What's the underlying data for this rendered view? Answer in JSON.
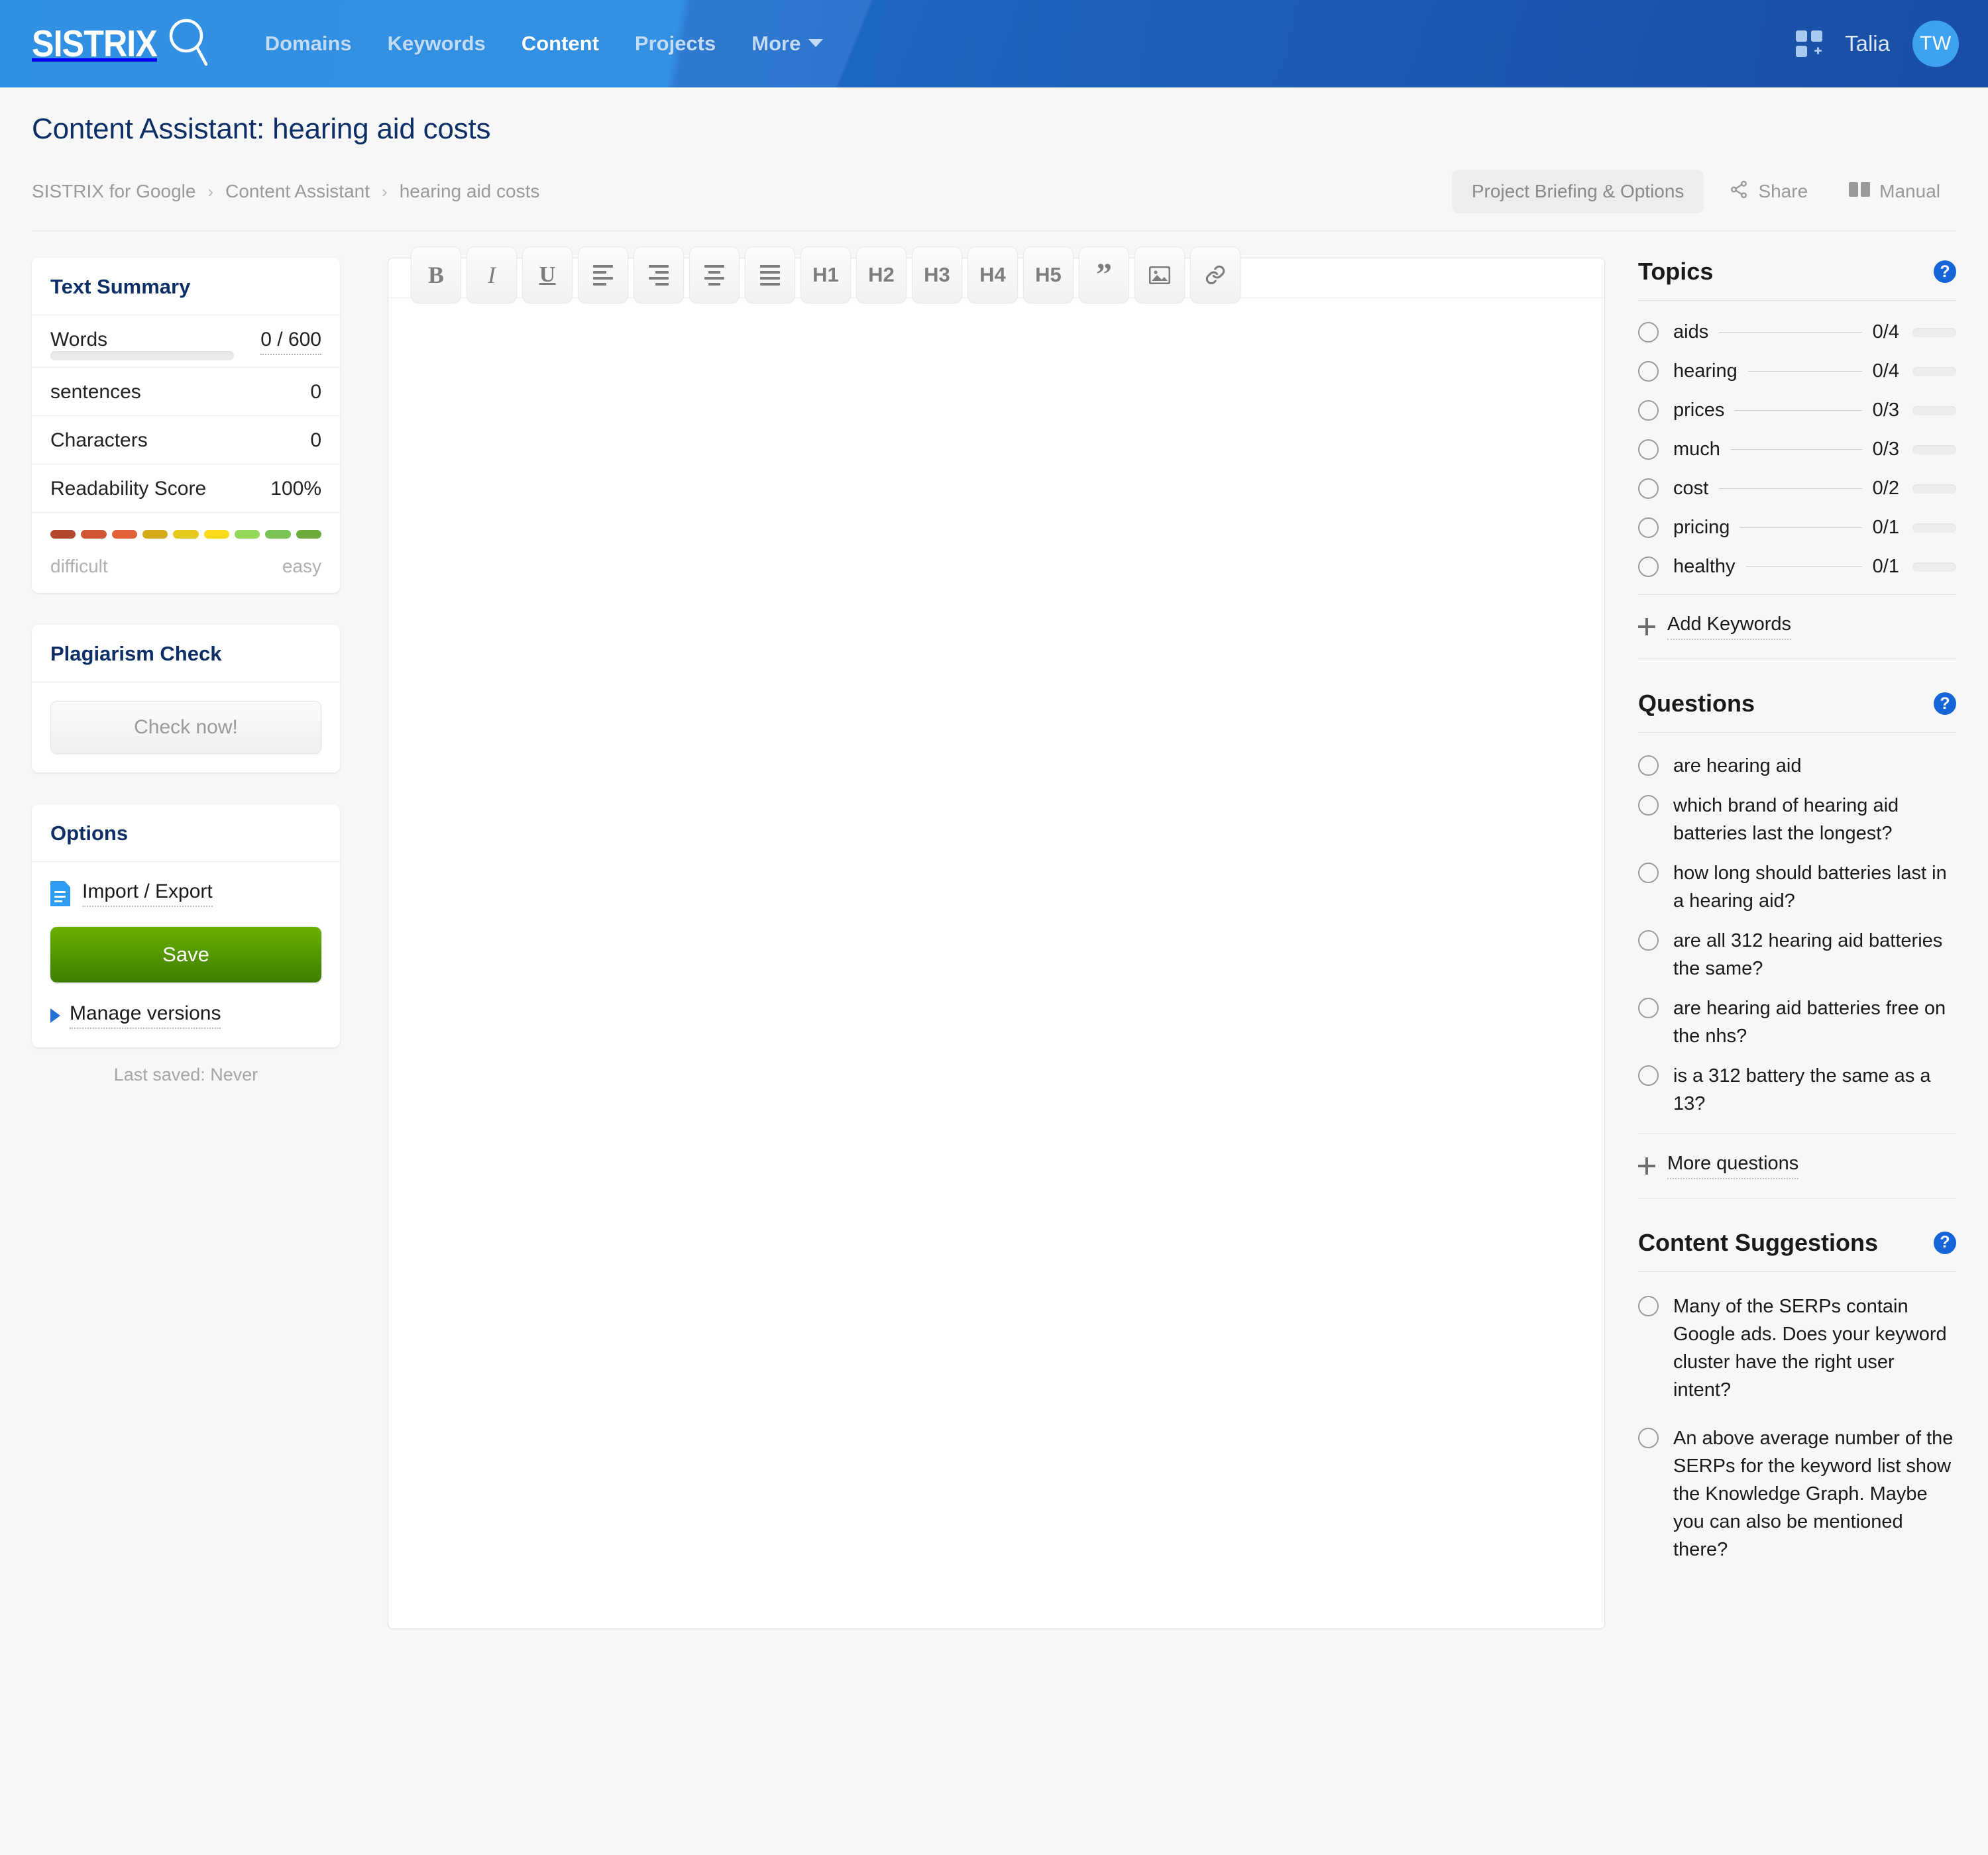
{
  "topnav": {
    "logo_text": "SISTRIX",
    "logo_icon": "magnifier-icon",
    "links": [
      {
        "label": "Domains",
        "active": false
      },
      {
        "label": "Keywords",
        "active": false
      },
      {
        "label": "Content",
        "active": true
      },
      {
        "label": "Projects",
        "active": false
      },
      {
        "label": "More",
        "active": false,
        "caret": true
      }
    ],
    "apps_icon": "grid-plus-icon",
    "user_name": "Talia",
    "avatar_initials": "TW",
    "avatar_color": "#3da2f0"
  },
  "pagehead": {
    "title": "Content Assistant: hearing aid costs",
    "breadcrumb": [
      "SISTRIX for Google",
      "Content Assistant",
      "hearing aid costs"
    ],
    "breadcrumb_separator": "›",
    "briefing_button": "Project Briefing & Options",
    "share_label": "Share",
    "manual_label": "Manual"
  },
  "text_summary": {
    "title": "Text Summary",
    "rows": [
      {
        "label": "Words",
        "value": "0 / 600",
        "has_bar": true,
        "dotted": true
      },
      {
        "label": "sentences",
        "value": "0",
        "has_bar": false,
        "dotted": false
      },
      {
        "label": "Characters",
        "value": "0",
        "has_bar": false,
        "dotted": false
      },
      {
        "label": "Readability Score",
        "value": "100%",
        "has_bar": false,
        "dotted": false
      }
    ],
    "readability_colors": [
      "#b4482f",
      "#cf5733",
      "#e06236",
      "#d5ab1c",
      "#e5c91c",
      "#fada1b",
      "#93d85a",
      "#79c455",
      "#6cab3c"
    ],
    "legend_left": "difficult",
    "legend_right": "easy",
    "words_progress_percent": 0
  },
  "plagiarism": {
    "title": "Plagiarism Check",
    "button": "Check now!"
  },
  "options": {
    "title": "Options",
    "import_export": "Import / Export",
    "import_export_icon": "document-icon",
    "save": "Save",
    "save_color": "#4f9200",
    "manage_versions": "Manage versions",
    "last_saved": "Last saved: Never"
  },
  "editor": {
    "toolbar": [
      {
        "label": "B",
        "name": "bold-button",
        "style": "serif"
      },
      {
        "label": "I",
        "name": "italic-button",
        "style": "italic"
      },
      {
        "label": "U",
        "name": "underline-button",
        "style": "under"
      },
      {
        "label": "",
        "name": "align-left-button",
        "style": "align",
        "align": "left"
      },
      {
        "label": "",
        "name": "align-right-button",
        "style": "align",
        "align": "right"
      },
      {
        "label": "",
        "name": "align-center-button",
        "style": "align",
        "align": "center"
      },
      {
        "label": "",
        "name": "align-justify-button",
        "style": "align",
        "align": "justify"
      },
      {
        "label": "H1",
        "name": "heading-1-button",
        "style": "text"
      },
      {
        "label": "H2",
        "name": "heading-2-button",
        "style": "text"
      },
      {
        "label": "H3",
        "name": "heading-3-button",
        "style": "text"
      },
      {
        "label": "H4",
        "name": "heading-4-button",
        "style": "text"
      },
      {
        "label": "H5",
        "name": "heading-5-button",
        "style": "text"
      },
      {
        "label": "”",
        "name": "blockquote-button",
        "style": "quote"
      },
      {
        "label": "",
        "name": "insert-image-button",
        "style": "image"
      },
      {
        "label": "",
        "name": "insert-link-button",
        "style": "link"
      }
    ],
    "content": ""
  },
  "topics": {
    "title": "Topics",
    "items": [
      {
        "name": "aids",
        "count": "0/4"
      },
      {
        "name": "hearing",
        "count": "0/4"
      },
      {
        "name": "prices",
        "count": "0/3"
      },
      {
        "name": "much",
        "count": "0/3"
      },
      {
        "name": "cost",
        "count": "0/2"
      },
      {
        "name": "pricing",
        "count": "0/1"
      },
      {
        "name": "healthy",
        "count": "0/1"
      }
    ],
    "add_keywords": "Add Keywords"
  },
  "questions": {
    "title": "Questions",
    "items": [
      "are hearing aid",
      "which brand of hearing aid batteries last the longest?",
      "how long should batteries last in a hearing aid?",
      "are all 312 hearing aid batteries the same?",
      "are hearing aid batteries free on the nhs?",
      "is a 312 battery the same as a 13?"
    ],
    "more": "More questions"
  },
  "content_suggestions": {
    "title": "Content Suggestions",
    "items": [
      "Many of the SERPs contain Google ads. Does your keyword cluster have the right user intent?",
      "An above average number of the SERPs for the keyword list show the Knowledge Graph. Maybe you can also be mentioned there?"
    ]
  }
}
